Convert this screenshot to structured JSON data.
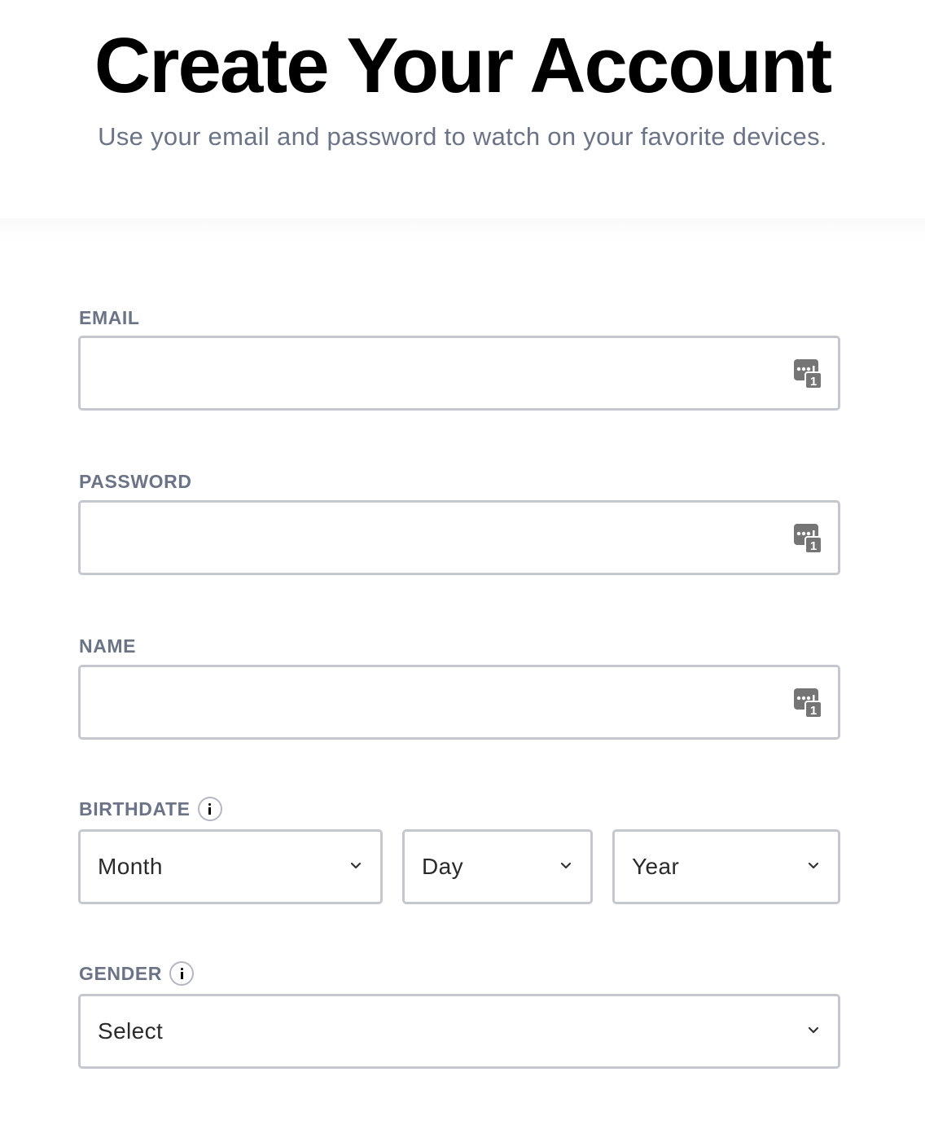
{
  "header": {
    "title": "Create Your Account",
    "subtitle": "Use your email and password to watch on your favorite devices."
  },
  "form": {
    "email": {
      "label": "EMAIL",
      "value": "",
      "placeholder": "",
      "icon": "password-manager-autofill-icon"
    },
    "password": {
      "label": "PASSWORD",
      "value": "",
      "placeholder": "",
      "icon": "password-manager-autofill-icon"
    },
    "name": {
      "label": "NAME",
      "value": "",
      "placeholder": "",
      "icon": "password-manager-autofill-icon"
    },
    "birthdate": {
      "label": "BIRTHDATE",
      "info_icon": "info-icon",
      "month": "Month",
      "day": "Day",
      "year": "Year"
    },
    "gender": {
      "label": "GENDER",
      "info_icon": "info-icon",
      "value": "Select"
    }
  },
  "colors": {
    "title": "#000000",
    "subtitle": "#6b7386",
    "label": "#6b7386",
    "input_border": "#c4c7ce",
    "autofill_icon": "#757575"
  }
}
